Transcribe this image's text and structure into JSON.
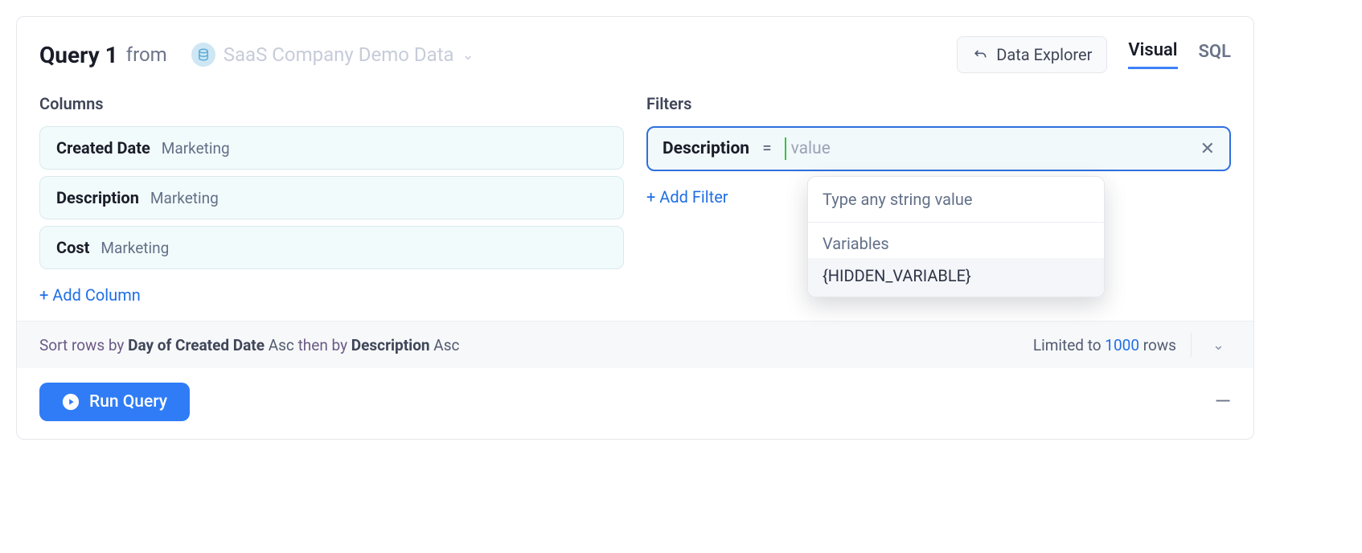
{
  "header": {
    "query_title": "Query 1",
    "from_label": "from",
    "datasource_name": "SaaS Company Demo Data",
    "explorer_label": "Data Explorer",
    "tabs": {
      "visual": "Visual",
      "sql": "SQL"
    }
  },
  "columns": {
    "title": "Columns",
    "items": [
      {
        "name": "Created Date",
        "tag": "Marketing"
      },
      {
        "name": "Description",
        "tag": "Marketing"
      },
      {
        "name": "Cost",
        "tag": "Marketing"
      }
    ],
    "add_label": "+ Add Column"
  },
  "filters": {
    "title": "Filters",
    "item": {
      "field": "Description",
      "operator": "=",
      "placeholder": "value"
    },
    "add_label": "+ Add Filter",
    "dropdown": {
      "hint": "Type any string value",
      "group_label": "Variables",
      "item": "{HIDDEN_VARIABLE}"
    }
  },
  "sort": {
    "prefix": "Sort rows by ",
    "field1": "Day of Created Date",
    "dir1": " Asc ",
    "then": "then by ",
    "field2": "Description",
    "dir2": " Asc",
    "limit_prefix": "Limited to ",
    "limit_num": "1000",
    "limit_suffix": " rows"
  },
  "run": {
    "label": "Run Query"
  }
}
